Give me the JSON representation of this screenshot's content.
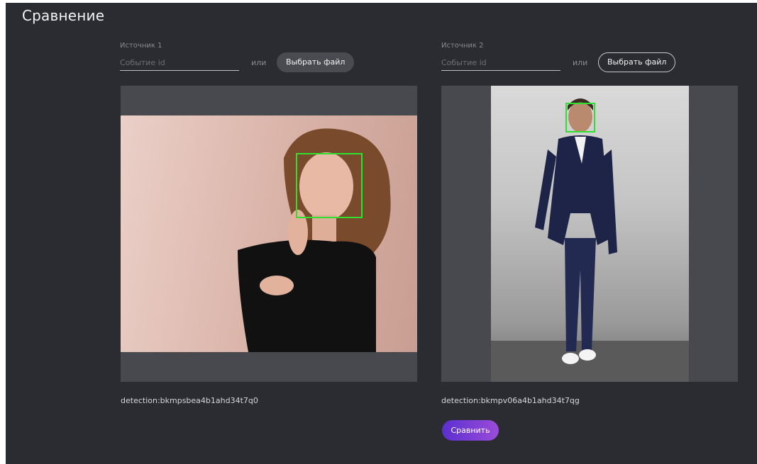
{
  "page": {
    "title": "Сравнение"
  },
  "sources": [
    {
      "label": "Источник 1",
      "event_placeholder": "Событие id",
      "or_text": "или",
      "file_button": "Выбрать файл",
      "detection": "detection:bkmpsbea4b1ahd34t7q0"
    },
    {
      "label": "Источник 2",
      "event_placeholder": "Событие id",
      "or_text": "или",
      "file_button": "Выбрать файл",
      "detection": "detection:bkmpv06a4b1ahd34t7qg"
    }
  ],
  "compare_button": "Сравнить",
  "colors": {
    "background": "#2b2c31",
    "preview_bg": "#48494e",
    "face_box": "#2fe02f",
    "accent_gradient": [
      "#5b2fd0",
      "#9b4cd9"
    ]
  }
}
